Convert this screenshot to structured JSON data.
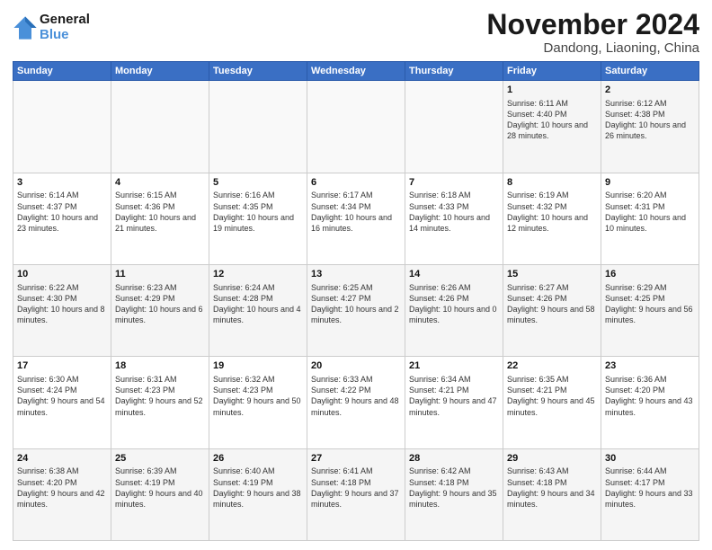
{
  "logo": {
    "line1": "General",
    "line2": "Blue"
  },
  "header": {
    "month": "November 2024",
    "location": "Dandong, Liaoning, China"
  },
  "days_of_week": [
    "Sunday",
    "Monday",
    "Tuesday",
    "Wednesday",
    "Thursday",
    "Friday",
    "Saturday"
  ],
  "weeks": [
    [
      {
        "day": "",
        "info": ""
      },
      {
        "day": "",
        "info": ""
      },
      {
        "day": "",
        "info": ""
      },
      {
        "day": "",
        "info": ""
      },
      {
        "day": "",
        "info": ""
      },
      {
        "day": "1",
        "info": "Sunrise: 6:11 AM\nSunset: 4:40 PM\nDaylight: 10 hours and 28 minutes."
      },
      {
        "day": "2",
        "info": "Sunrise: 6:12 AM\nSunset: 4:38 PM\nDaylight: 10 hours and 26 minutes."
      }
    ],
    [
      {
        "day": "3",
        "info": "Sunrise: 6:14 AM\nSunset: 4:37 PM\nDaylight: 10 hours and 23 minutes."
      },
      {
        "day": "4",
        "info": "Sunrise: 6:15 AM\nSunset: 4:36 PM\nDaylight: 10 hours and 21 minutes."
      },
      {
        "day": "5",
        "info": "Sunrise: 6:16 AM\nSunset: 4:35 PM\nDaylight: 10 hours and 19 minutes."
      },
      {
        "day": "6",
        "info": "Sunrise: 6:17 AM\nSunset: 4:34 PM\nDaylight: 10 hours and 16 minutes."
      },
      {
        "day": "7",
        "info": "Sunrise: 6:18 AM\nSunset: 4:33 PM\nDaylight: 10 hours and 14 minutes."
      },
      {
        "day": "8",
        "info": "Sunrise: 6:19 AM\nSunset: 4:32 PM\nDaylight: 10 hours and 12 minutes."
      },
      {
        "day": "9",
        "info": "Sunrise: 6:20 AM\nSunset: 4:31 PM\nDaylight: 10 hours and 10 minutes."
      }
    ],
    [
      {
        "day": "10",
        "info": "Sunrise: 6:22 AM\nSunset: 4:30 PM\nDaylight: 10 hours and 8 minutes."
      },
      {
        "day": "11",
        "info": "Sunrise: 6:23 AM\nSunset: 4:29 PM\nDaylight: 10 hours and 6 minutes."
      },
      {
        "day": "12",
        "info": "Sunrise: 6:24 AM\nSunset: 4:28 PM\nDaylight: 10 hours and 4 minutes."
      },
      {
        "day": "13",
        "info": "Sunrise: 6:25 AM\nSunset: 4:27 PM\nDaylight: 10 hours and 2 minutes."
      },
      {
        "day": "14",
        "info": "Sunrise: 6:26 AM\nSunset: 4:26 PM\nDaylight: 10 hours and 0 minutes."
      },
      {
        "day": "15",
        "info": "Sunrise: 6:27 AM\nSunset: 4:26 PM\nDaylight: 9 hours and 58 minutes."
      },
      {
        "day": "16",
        "info": "Sunrise: 6:29 AM\nSunset: 4:25 PM\nDaylight: 9 hours and 56 minutes."
      }
    ],
    [
      {
        "day": "17",
        "info": "Sunrise: 6:30 AM\nSunset: 4:24 PM\nDaylight: 9 hours and 54 minutes."
      },
      {
        "day": "18",
        "info": "Sunrise: 6:31 AM\nSunset: 4:23 PM\nDaylight: 9 hours and 52 minutes."
      },
      {
        "day": "19",
        "info": "Sunrise: 6:32 AM\nSunset: 4:23 PM\nDaylight: 9 hours and 50 minutes."
      },
      {
        "day": "20",
        "info": "Sunrise: 6:33 AM\nSunset: 4:22 PM\nDaylight: 9 hours and 48 minutes."
      },
      {
        "day": "21",
        "info": "Sunrise: 6:34 AM\nSunset: 4:21 PM\nDaylight: 9 hours and 47 minutes."
      },
      {
        "day": "22",
        "info": "Sunrise: 6:35 AM\nSunset: 4:21 PM\nDaylight: 9 hours and 45 minutes."
      },
      {
        "day": "23",
        "info": "Sunrise: 6:36 AM\nSunset: 4:20 PM\nDaylight: 9 hours and 43 minutes."
      }
    ],
    [
      {
        "day": "24",
        "info": "Sunrise: 6:38 AM\nSunset: 4:20 PM\nDaylight: 9 hours and 42 minutes."
      },
      {
        "day": "25",
        "info": "Sunrise: 6:39 AM\nSunset: 4:19 PM\nDaylight: 9 hours and 40 minutes."
      },
      {
        "day": "26",
        "info": "Sunrise: 6:40 AM\nSunset: 4:19 PM\nDaylight: 9 hours and 38 minutes."
      },
      {
        "day": "27",
        "info": "Sunrise: 6:41 AM\nSunset: 4:18 PM\nDaylight: 9 hours and 37 minutes."
      },
      {
        "day": "28",
        "info": "Sunrise: 6:42 AM\nSunset: 4:18 PM\nDaylight: 9 hours and 35 minutes."
      },
      {
        "day": "29",
        "info": "Sunrise: 6:43 AM\nSunset: 4:18 PM\nDaylight: 9 hours and 34 minutes."
      },
      {
        "day": "30",
        "info": "Sunrise: 6:44 AM\nSunset: 4:17 PM\nDaylight: 9 hours and 33 minutes."
      }
    ]
  ]
}
